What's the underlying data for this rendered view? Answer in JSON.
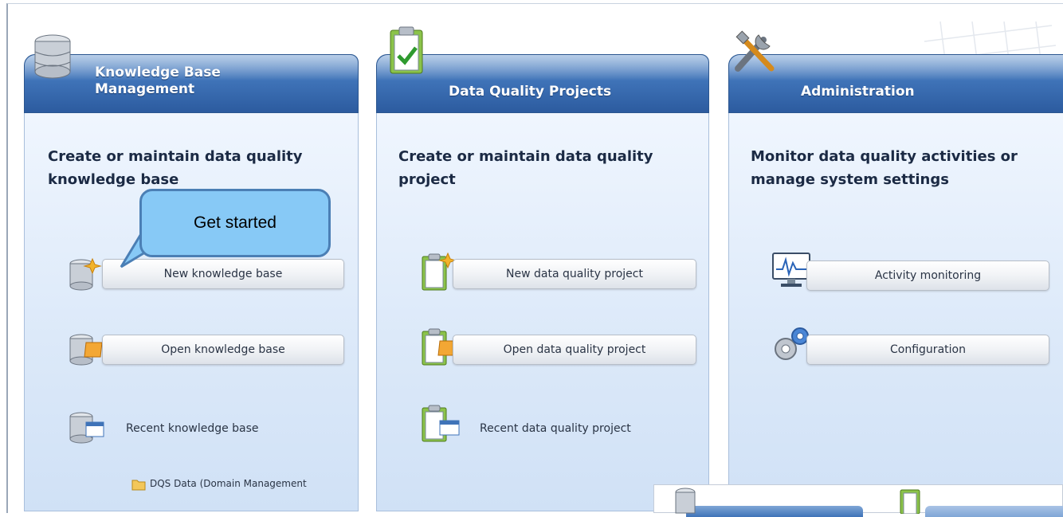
{
  "panels": [
    {
      "tab_title_line1": "Knowledge Base",
      "tab_title_line2": "Management",
      "heading_line1": "Create or maintain data quality",
      "heading_line2": "knowledge base",
      "actions": [
        {
          "label": "New knowledge base"
        },
        {
          "label": "Open knowledge base"
        },
        {
          "label": "Recent knowledge base"
        }
      ],
      "recent_item": "DQS Data (Domain Management"
    },
    {
      "tab_title": "Data Quality Projects",
      "heading_line1": "Create or maintain data quality",
      "heading_line2": "project",
      "actions": [
        {
          "label": "New data quality project"
        },
        {
          "label": "Open data quality project"
        },
        {
          "label": "Recent data quality project"
        }
      ]
    },
    {
      "tab_title": "Administration",
      "heading_line1": "Monitor data quality activities or",
      "heading_line2": "manage system settings",
      "actions": [
        {
          "label": "Activity monitoring"
        },
        {
          "label": "Configuration"
        }
      ]
    }
  ],
  "callout": {
    "text": "Get started"
  },
  "icons": {
    "kb_tab": "database-icon",
    "dq_tab": "clipboard-check-icon",
    "admin_tab": "tools-icon",
    "new_kb": "database-new-icon",
    "open_kb": "database-open-icon",
    "recent_kb": "database-recent-icon",
    "new_dq": "clipboard-new-icon",
    "open_dq": "clipboard-open-icon",
    "recent_dq": "clipboard-recent-icon",
    "monitor": "monitor-chart-icon",
    "config": "gears-icon"
  },
  "colors": {
    "tab_blue": "#3f73b8",
    "panel_bg": "#dce9f9",
    "callout_fill": "#87c9f6",
    "callout_border": "#4b7fb5"
  }
}
